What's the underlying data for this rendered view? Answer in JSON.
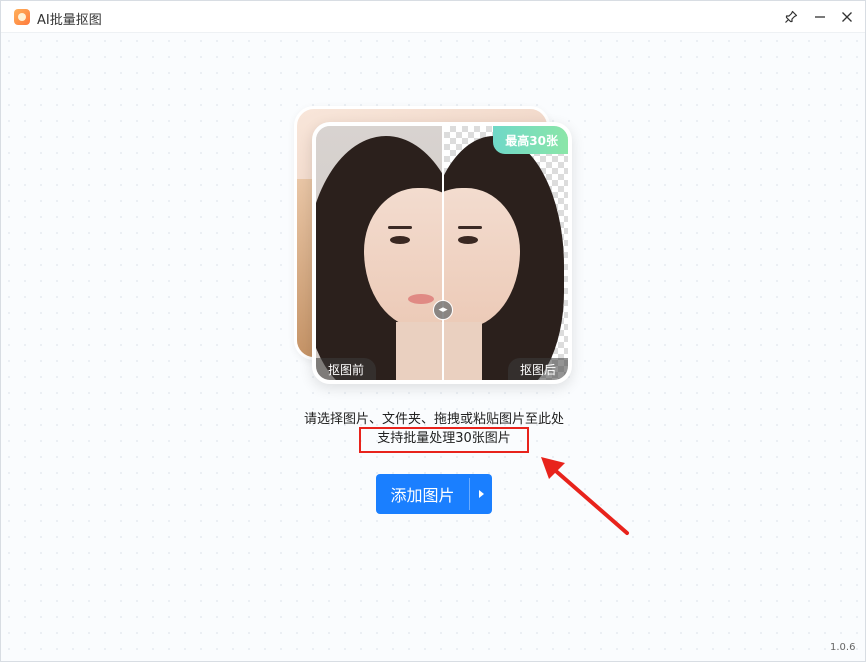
{
  "window": {
    "title": "AI批量抠图"
  },
  "showcase": {
    "badge": "最高30张",
    "before_label": "抠图前",
    "after_label": "抠图后"
  },
  "hints": {
    "line1": "请选择图片、文件夹、拖拽或粘贴图片至此处",
    "line2": "支持批量处理30张图片"
  },
  "actions": {
    "add_label": "添加图片"
  },
  "footer": {
    "version": "1.0.6"
  },
  "colors": {
    "primary": "#1a7fff",
    "highlight": "#e8231c",
    "badge": "#6fd8c8"
  },
  "icons": [
    "app-logo-icon",
    "pin-icon",
    "minimize-icon",
    "close-icon",
    "compare-handle-icon",
    "caret-right-icon",
    "red-arrow-icon"
  ]
}
